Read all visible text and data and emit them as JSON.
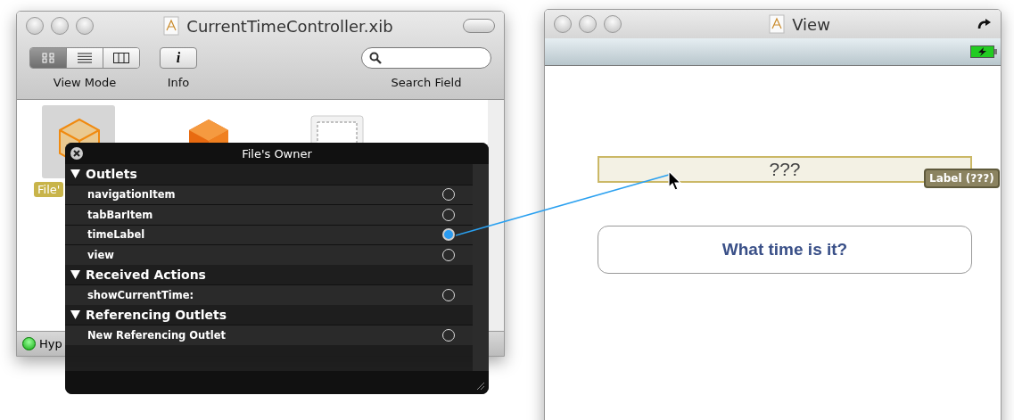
{
  "document_window": {
    "title": "CurrentTimeController.xib",
    "toolbar": [
      {
        "kind": "segmented",
        "label": "View Mode",
        "segments": [
          {
            "kind": "grid",
            "selected": true
          },
          {
            "kind": "list",
            "selected": false
          },
          {
            "kind": "columns",
            "selected": false
          }
        ]
      },
      {
        "kind": "info",
        "label": "Info",
        "glyph": "i"
      },
      {
        "kind": "search",
        "label": "Search Field"
      }
    ],
    "objects": [
      {
        "kind": "cube",
        "label": "File'",
        "selected": true
      },
      {
        "kind": "responder",
        "selected": false
      },
      {
        "kind": "view",
        "selected": false
      }
    ],
    "status": "Hyp"
  },
  "hud": {
    "title": "File's Owner",
    "sections": [
      {
        "title": "Outlets",
        "expanded": true,
        "rows": [
          {
            "name": "navigationItem",
            "connected": false
          },
          {
            "name": "tabBarItem",
            "connected": false
          },
          {
            "name": "timeLabel",
            "connected": true
          },
          {
            "name": "view",
            "connected": false
          }
        ]
      },
      {
        "title": "Received Actions",
        "expanded": true,
        "rows": [
          {
            "name": "showCurrentTime:",
            "connected": false
          }
        ]
      },
      {
        "title": "Referencing Outlets",
        "expanded": true,
        "rows": [
          {
            "name": "New Referencing Outlet",
            "connected": false
          }
        ]
      }
    ]
  },
  "view_window": {
    "title": "View",
    "label": {
      "text": "???",
      "selected": true,
      "badge": "Label (???)"
    },
    "button": "What time is it?"
  }
}
